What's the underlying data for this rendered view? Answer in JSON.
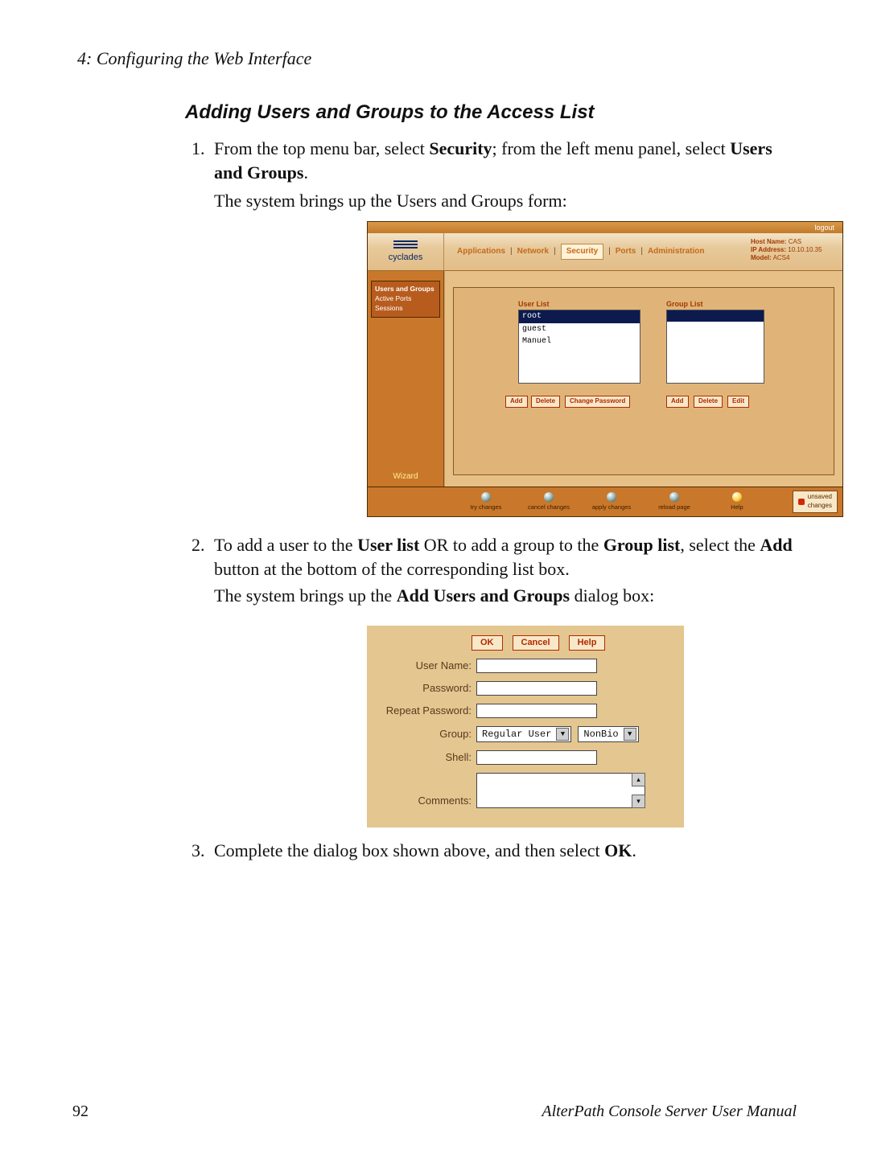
{
  "doc": {
    "running_header": "4: Configuring the Web Interface",
    "section_title": "Adding Users and Groups to the Access List",
    "step1_a": "From the top menu bar, select ",
    "step1_bold1": "Security",
    "step1_b": "; from the left menu panel, select ",
    "step1_bold2": "Users and Groups",
    "step1_c": ".",
    "step1_caption": "The system brings up the Users and Groups form:",
    "step2_a": "To add a user to the ",
    "step2_bold1": "User list",
    "step2_b": " OR to add a group to the ",
    "step2_bold2": "Group list",
    "step2_c": ", select the ",
    "step2_bold3": "Add",
    "step2_d": " button at the bottom of the corresponding list box.",
    "step2_caption_a": "The system brings up the ",
    "step2_caption_bold": "Add Users and Groups",
    "step2_caption_b": " dialog box:",
    "step3_a": "Complete the dialog box shown above, and then select ",
    "step3_bold": "OK",
    "step3_b": ".",
    "page_number": "92",
    "manual_title": "AlterPath Console Server User Manual"
  },
  "shot1": {
    "logout": "logout",
    "brand": "cyclades",
    "menu": {
      "items": [
        "Applications",
        "Network",
        "Security",
        "Ports",
        "Administration"
      ],
      "selected": "Security",
      "sep": "|"
    },
    "host_info": {
      "l1k": "Host Name:",
      "l1v": "CAS",
      "l2k": "IP Address:",
      "l2v": "10.10.10.35",
      "l3k": "Model:",
      "l3v": "ACS4"
    },
    "side": {
      "nav1": "Users and Groups",
      "nav2": "Active Ports Sessions",
      "wizard": "Wizard"
    },
    "userlist": {
      "title": "User List",
      "items": [
        "root",
        "guest",
        "Manuel"
      ],
      "btn_add": "Add",
      "btn_delete": "Delete",
      "btn_chpw": "Change Password"
    },
    "grouplist": {
      "title": "Group List",
      "btn_add": "Add",
      "btn_delete": "Delete",
      "btn_edit": "Edit"
    },
    "footer": {
      "try": "try changes",
      "cancel": "cancel changes",
      "apply": "apply changes",
      "reload": "reload page",
      "help": "Help",
      "unsaved": "unsaved\nchanges"
    }
  },
  "dialog": {
    "buttons": {
      "ok": "OK",
      "cancel": "Cancel",
      "help": "Help"
    },
    "labels": {
      "username": "User Name:",
      "password": "Password:",
      "repeat": "Repeat Password:",
      "group": "Group:",
      "shell": "Shell:",
      "comments": "Comments:"
    },
    "values": {
      "username": "",
      "password": "",
      "repeat": "",
      "group_select": "Regular User",
      "group_extra_select": "NonBio",
      "shell": "",
      "comments": ""
    }
  }
}
